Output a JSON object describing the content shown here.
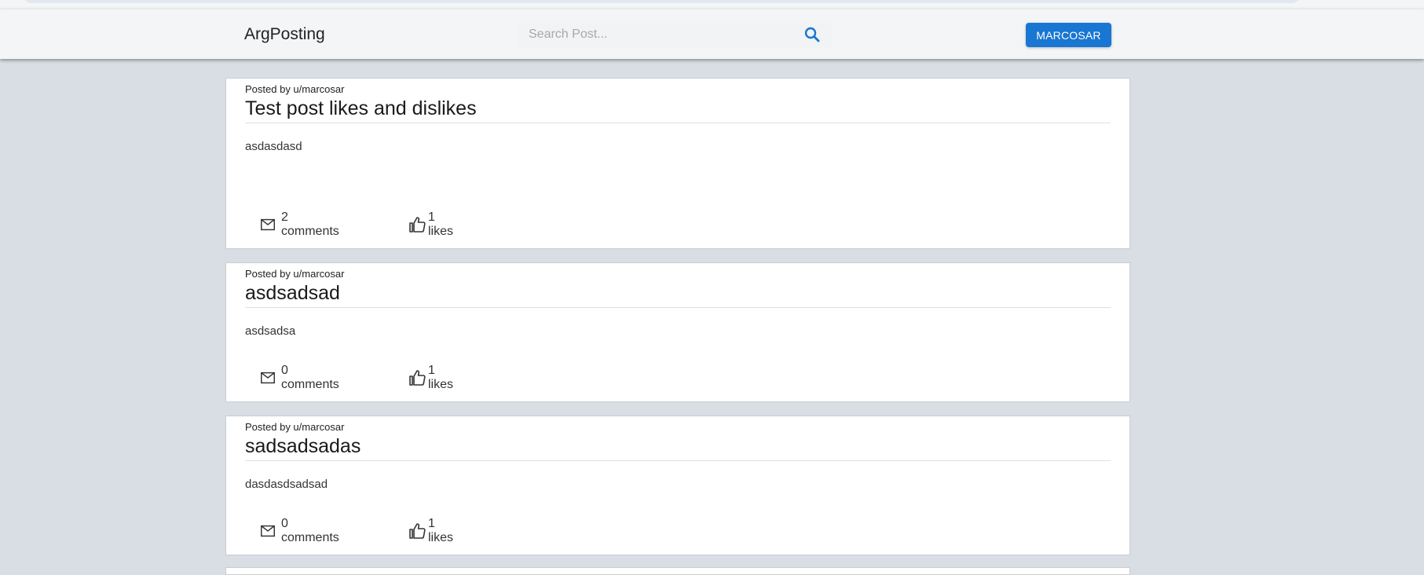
{
  "header": {
    "brand": "ArgPosting",
    "search_placeholder": "Search Post...",
    "user_button": "MARCOSAR",
    "accent_color": "#1976d2"
  },
  "posts": [
    {
      "author": "Posted by u/marcosar",
      "title": "Test post likes and dislikes",
      "body": "asdasdasd",
      "comments": "2 comments",
      "likes": "1 likes"
    },
    {
      "author": "Posted by u/marcosar",
      "title": "asdsadsad",
      "body": "asdsadsa",
      "comments": "0 comments",
      "likes": "1 likes"
    },
    {
      "author": "Posted by u/marcosar",
      "title": "sadsadsadas",
      "body": "dasdasdsadsad",
      "comments": "0 comments",
      "likes": "1 likes"
    }
  ],
  "icons": {
    "search": "search-icon",
    "comments": "mail-icon",
    "likes": "thumb-up-icon"
  }
}
